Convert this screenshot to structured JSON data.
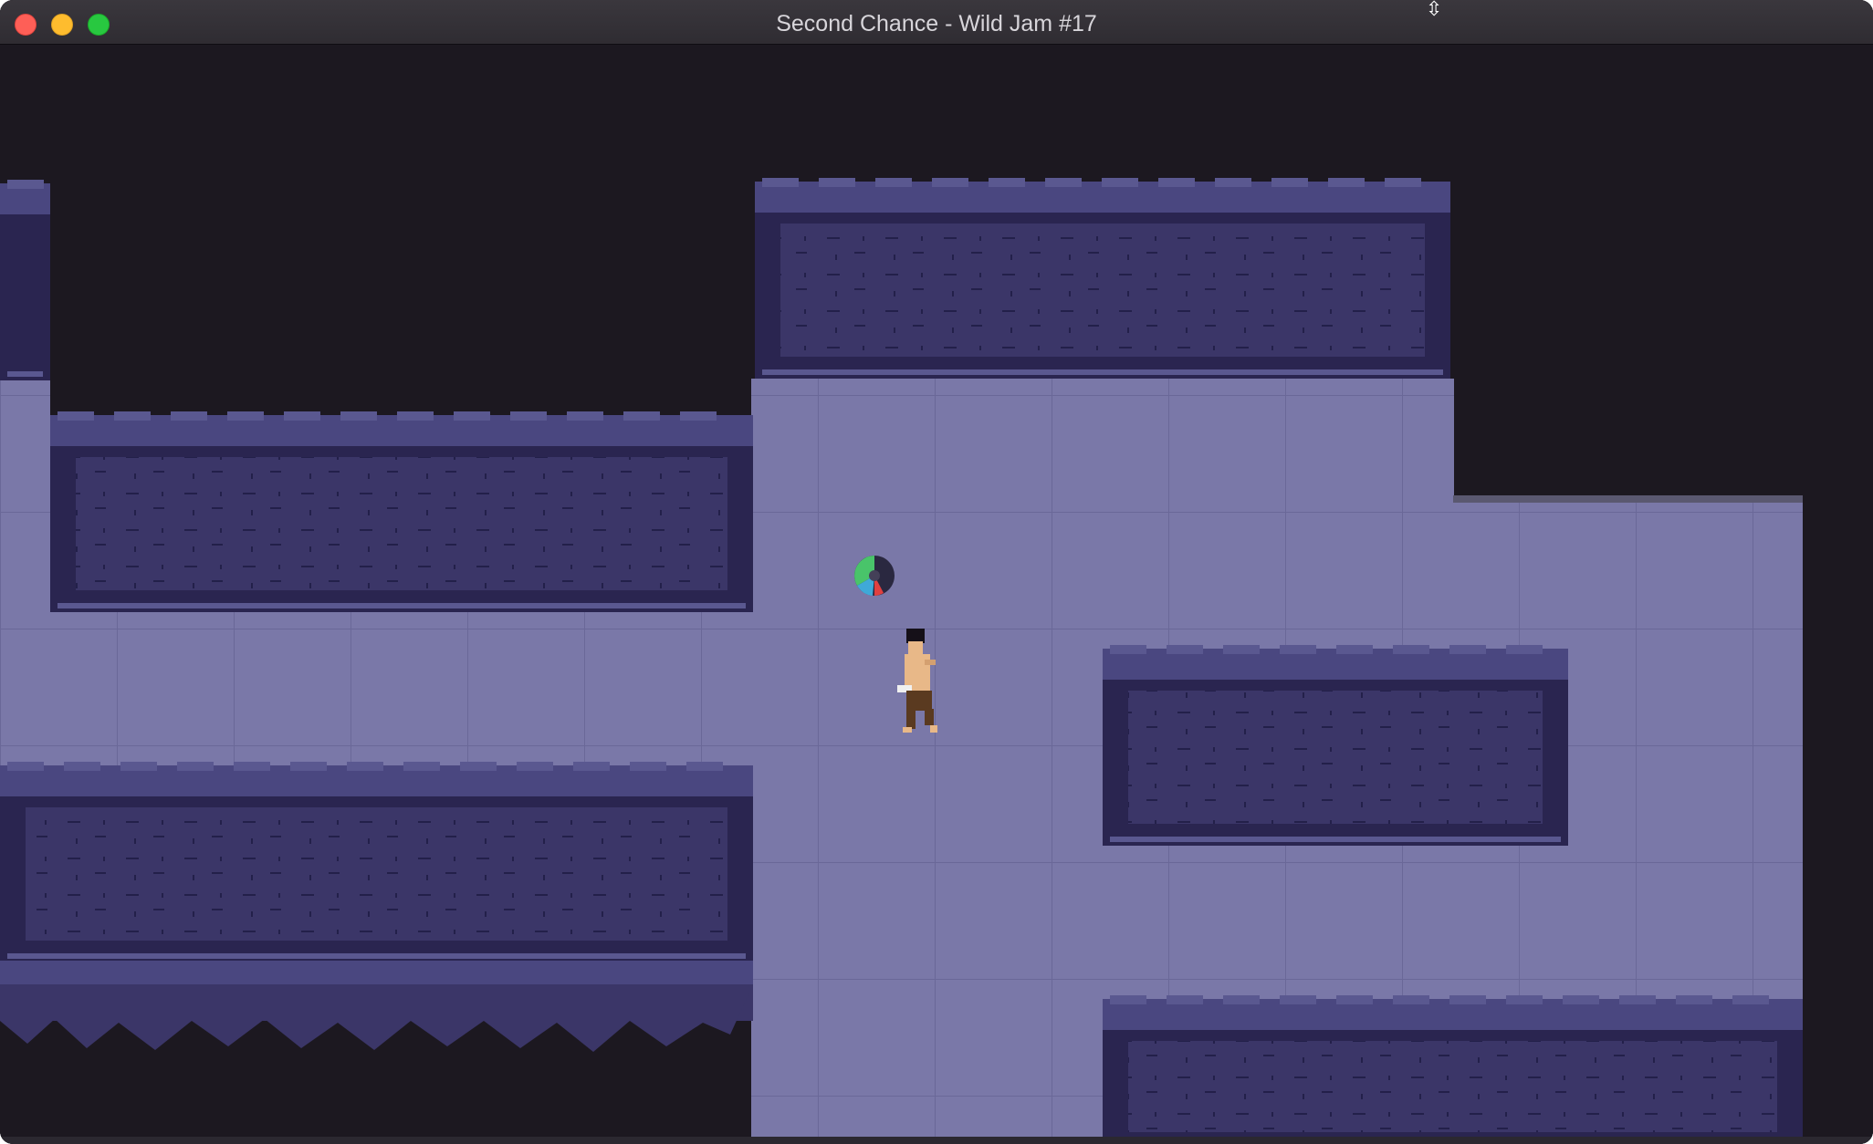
{
  "window": {
    "title": "Second Chance - Wild Jam #17"
  },
  "titlebar": {
    "buttons": [
      "close-button",
      "minimize-button",
      "zoom-button"
    ],
    "cursor_icon": "resize-vertical-cursor-icon"
  },
  "colors": {
    "void": "#1c1820",
    "floor": "#7a78a8",
    "floor_line": "#6a6898",
    "wall_face": "#3b3668",
    "wall_top": "#5a5890",
    "wall_shadow": "#2a2550",
    "player_skin": "#e8b888",
    "player_pants": "#5a3a20",
    "player_hair": "#151018"
  },
  "hud": {
    "cooldown_icon": "cooldown-ring-icon"
  }
}
